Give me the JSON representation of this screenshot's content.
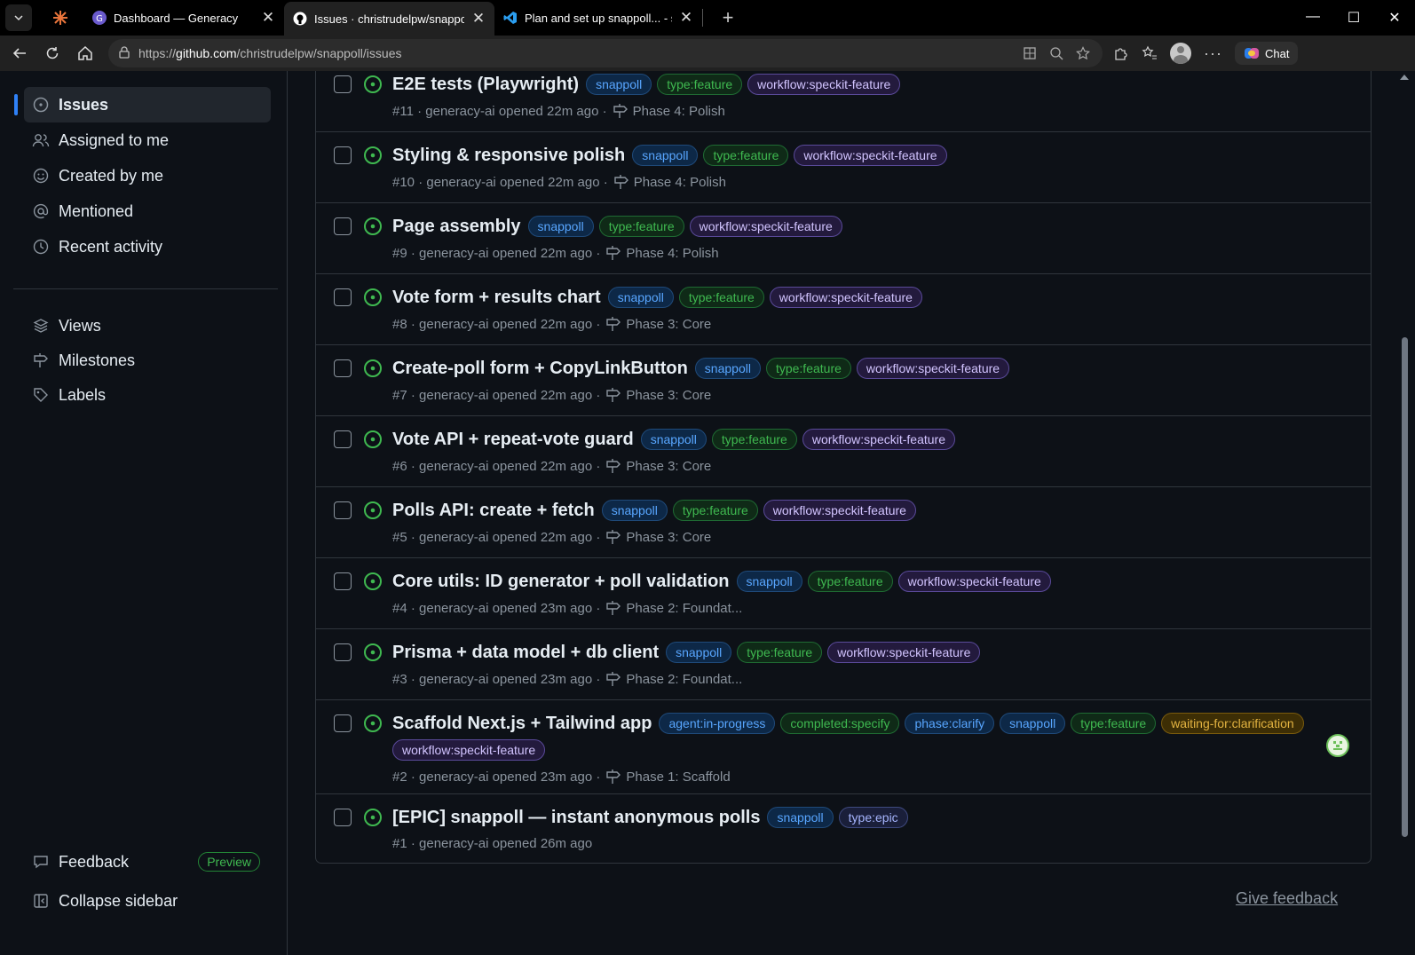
{
  "browser": {
    "tabs": [
      {
        "title": "Dashboard — Generacy",
        "icon": "generacy-icon"
      },
      {
        "title": "Issues · christrudelpw/snappoll",
        "icon": "github-icon"
      },
      {
        "title": "Plan and set up snappoll... - snappoll",
        "icon": "vscode-icon"
      }
    ],
    "url_prefix": "https://",
    "url_host": "github.com",
    "url_path": "/christrudelpw/snappoll/issues",
    "chat_label": "Chat"
  },
  "sidebar": {
    "items": [
      {
        "label": "Issues",
        "icon": "issue-opened-icon",
        "active": true
      },
      {
        "label": "Assigned to me",
        "icon": "people-icon"
      },
      {
        "label": "Created by me",
        "icon": "smiley-icon"
      },
      {
        "label": "Mentioned",
        "icon": "mention-icon"
      },
      {
        "label": "Recent activity",
        "icon": "clock-icon"
      }
    ],
    "secondary": [
      {
        "label": "Views",
        "icon": "stack-icon"
      },
      {
        "label": "Milestones",
        "icon": "milestone-icon"
      },
      {
        "label": "Labels",
        "icon": "tag-icon"
      }
    ],
    "feedback_label": "Feedback",
    "preview_label": "Preview",
    "collapse_label": "Collapse sidebar"
  },
  "issues": [
    {
      "title": "E2E tests (Playwright)",
      "labels": [
        "snappoll",
        "type:feature",
        "workflow:speckit-feature"
      ],
      "number": "#11",
      "author": "generacy-ai",
      "opened": "opened 22m ago",
      "milestone": "Phase 4: Polish"
    },
    {
      "title": "Styling & responsive polish",
      "labels": [
        "snappoll",
        "type:feature",
        "workflow:speckit-feature"
      ],
      "number": "#10",
      "author": "generacy-ai",
      "opened": "opened 22m ago",
      "milestone": "Phase 4: Polish"
    },
    {
      "title": "Page assembly",
      "labels": [
        "snappoll",
        "type:feature",
        "workflow:speckit-feature"
      ],
      "number": "#9",
      "author": "generacy-ai",
      "opened": "opened 22m ago",
      "milestone": "Phase 4: Polish"
    },
    {
      "title": "Vote form + results chart",
      "labels": [
        "snappoll",
        "type:feature",
        "workflow:speckit-feature"
      ],
      "number": "#8",
      "author": "generacy-ai",
      "opened": "opened 22m ago",
      "milestone": "Phase 3: Core"
    },
    {
      "title": "Create-poll form + CopyLinkButton",
      "labels": [
        "snappoll",
        "type:feature",
        "workflow:speckit-feature"
      ],
      "number": "#7",
      "author": "generacy-ai",
      "opened": "opened 22m ago",
      "milestone": "Phase 3: Core"
    },
    {
      "title": "Vote API + repeat-vote guard",
      "labels": [
        "snappoll",
        "type:feature",
        "workflow:speckit-feature"
      ],
      "number": "#6",
      "author": "generacy-ai",
      "opened": "opened 22m ago",
      "milestone": "Phase 3: Core"
    },
    {
      "title": "Polls API: create + fetch",
      "labels": [
        "snappoll",
        "type:feature",
        "workflow:speckit-feature"
      ],
      "number": "#5",
      "author": "generacy-ai",
      "opened": "opened 22m ago",
      "milestone": "Phase 3: Core"
    },
    {
      "title": "Core utils: ID generator + poll validation",
      "labels": [
        "snappoll",
        "type:feature",
        "workflow:speckit-feature"
      ],
      "number": "#4",
      "author": "generacy-ai",
      "opened": "opened 23m ago",
      "milestone": "Phase 2: Foundat..."
    },
    {
      "title": "Prisma + data model + db client",
      "labels": [
        "snappoll",
        "type:feature",
        "workflow:speckit-feature"
      ],
      "number": "#3",
      "author": "generacy-ai",
      "opened": "opened 23m ago",
      "milestone": "Phase 2: Foundat..."
    },
    {
      "title": "Scaffold Next.js + Tailwind app",
      "labels": [
        "agent:in-progress",
        "completed:specify",
        "phase:clarify",
        "snappoll",
        "type:feature",
        "waiting-for:clarification",
        "workflow:speckit-feature"
      ],
      "number": "#2",
      "author": "generacy-ai",
      "opened": "opened 23m ago",
      "milestone": "Phase 1: Scaffold",
      "assignee": true
    },
    {
      "title": "[EPIC] snappoll — instant anonymous polls",
      "labels": [
        "snappoll",
        "type:epic"
      ],
      "number": "#1",
      "author": "generacy-ai",
      "opened": "opened 26m ago",
      "milestone": ""
    }
  ],
  "footer": {
    "give_feedback": "Give feedback"
  },
  "colors": {
    "accent": "#2f81f7",
    "open_issue": "#3fb950",
    "page_bg": "#0d1117",
    "border": "#30363d"
  }
}
